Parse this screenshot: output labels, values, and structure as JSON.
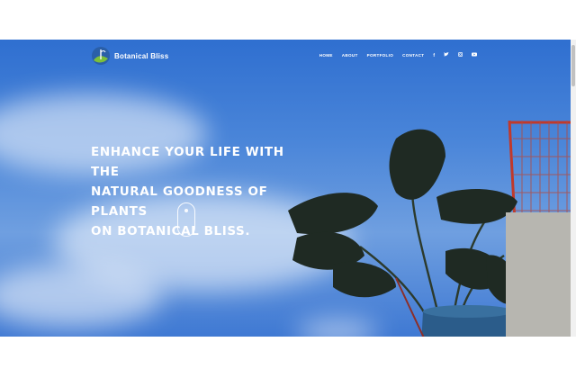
{
  "brand": {
    "name": "Botanical Bliss"
  },
  "nav": {
    "items": [
      "HOME",
      "ABOUT",
      "PORTFOLIO",
      "CONTACT"
    ],
    "social_icons": [
      "facebook-icon",
      "twitter-icon",
      "instagram-icon",
      "youtube-icon"
    ]
  },
  "hero": {
    "line1": "ENHANCE YOUR LIFE WITH THE",
    "line2": "NATURAL GOODNESS OF PLANTS",
    "line3": "ON BOTANICAL BLISS."
  },
  "colors": {
    "sky": "#3f79d3",
    "text": "#ffffff",
    "railing": "#c0392b",
    "pot": "#2b5c8a"
  }
}
